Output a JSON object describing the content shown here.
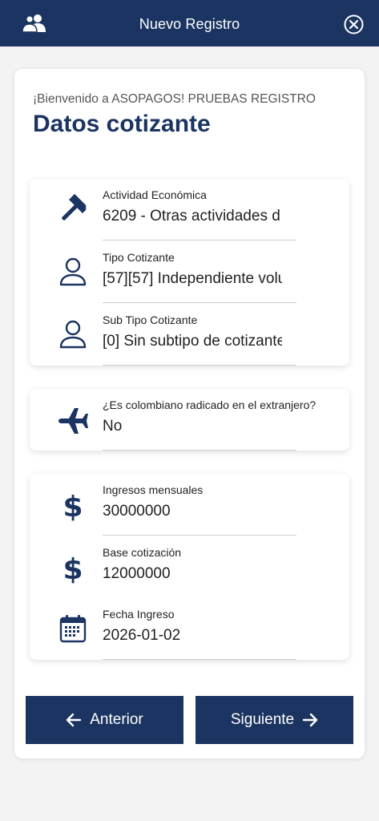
{
  "header": {
    "title": "Nuevo Registro",
    "left_icon": "users-icon",
    "right_icon": "close-circle-icon"
  },
  "intro": {
    "welcome": "¡Bienvenido a ASOPAGOS! PRUEBAS REGISTRO",
    "heading": "Datos cotizante"
  },
  "group1": {
    "actividad": {
      "icon": "hammer-icon",
      "label": "Actividad Económica",
      "value": "6209 - Otras actividades d"
    },
    "tipo": {
      "icon": "user-icon",
      "label": "Tipo Cotizante",
      "value": "[57][57] Independiente volu"
    },
    "subtipo": {
      "icon": "user-icon",
      "label": "Sub Tipo Cotizante",
      "value": "[0] Sin subtipo de cotizante"
    }
  },
  "group2": {
    "extranjero": {
      "icon": "airplane-icon",
      "label": "¿Es colombiano radicado en el extranjero?",
      "value": "No"
    }
  },
  "group3": {
    "ingresos": {
      "icon": "dollar-icon",
      "label": "Ingresos mensuales",
      "value": "30000000"
    },
    "base": {
      "icon": "dollar-icon",
      "label": "Base cotización",
      "value": "12000000"
    },
    "fecha": {
      "icon": "calendar-icon",
      "label": "Fecha Ingreso",
      "value": "2026-01-02"
    }
  },
  "buttons": {
    "anterior": "Anterior",
    "siguiente": "Siguiente"
  },
  "colors": {
    "primary": "#1b3461",
    "background": "#f3f3f3"
  }
}
